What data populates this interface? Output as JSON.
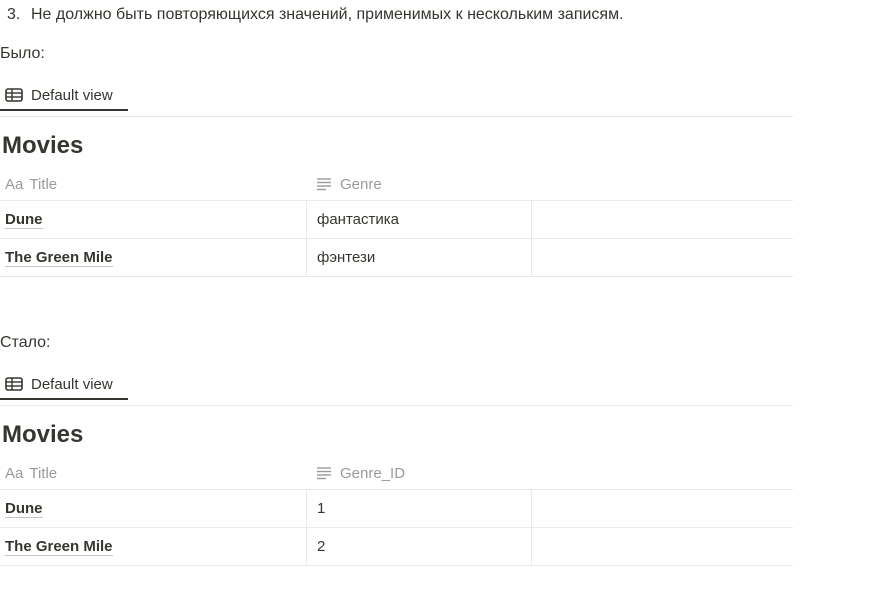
{
  "list_item": {
    "number": "3.",
    "text": "Не должно быть повторяющихся значений, применимых к нескольким записям."
  },
  "sections": [
    {
      "label": "Было:",
      "tab_label": "Default view",
      "db_title": "Movies",
      "columns": [
        {
          "icon": "text-aa-icon",
          "glyph": "Aa",
          "label": "Title"
        },
        {
          "icon": "lines-icon",
          "label": "Genre"
        }
      ],
      "rows": [
        {
          "title": "Dune",
          "value": "фантастика"
        },
        {
          "title": "The Green Mile",
          "value": "фэнтези"
        }
      ]
    },
    {
      "label": "Стало:",
      "tab_label": "Default view",
      "db_title": "Movies",
      "columns": [
        {
          "icon": "text-aa-icon",
          "glyph": "Aa",
          "label": "Title"
        },
        {
          "icon": "lines-icon",
          "label": "Genre_ID"
        }
      ],
      "rows": [
        {
          "title": "Dune",
          "value": "1"
        },
        {
          "title": "The Green Mile",
          "value": "2"
        }
      ]
    }
  ]
}
